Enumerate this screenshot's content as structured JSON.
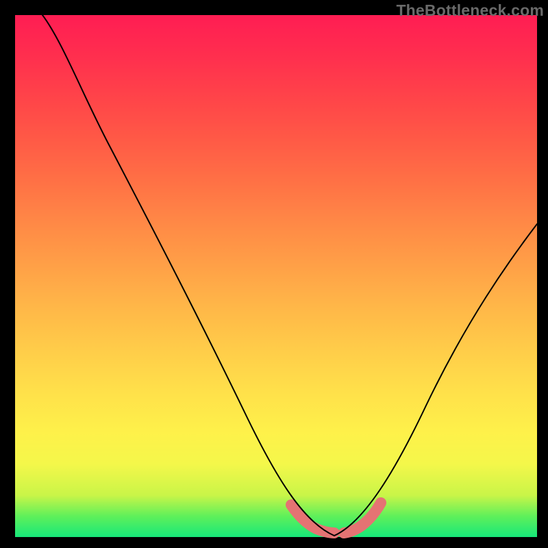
{
  "watermark": "TheBottleneck.com",
  "colors": {
    "frame": "#000000",
    "curve": "#000000",
    "highlight": "#e57373",
    "gradient_stops": [
      "#16e87a",
      "#fef14a",
      "#ff1d53"
    ]
  },
  "chart_data": {
    "type": "line",
    "title": "",
    "xlabel": "",
    "ylabel": "",
    "xlim": [
      0,
      100
    ],
    "ylim": [
      0,
      100
    ],
    "grid": false,
    "legend": false,
    "series": [
      {
        "name": "bottleneck-curve",
        "x": [
          0,
          5,
          10,
          15,
          20,
          25,
          30,
          35,
          40,
          45,
          50,
          55,
          57,
          59,
          61,
          63,
          65,
          67,
          70,
          75,
          80,
          85,
          90,
          95,
          100
        ],
        "values": [
          100,
          100,
          94,
          87,
          80,
          72,
          64,
          55,
          46,
          36,
          26,
          15,
          10,
          5,
          2,
          0,
          0,
          2,
          6,
          14,
          24,
          34,
          44,
          53,
          60
        ]
      },
      {
        "name": "optimal-zone-highlight",
        "x": [
          55,
          57,
          59,
          61,
          63,
          65,
          67,
          69
        ],
        "values": [
          6,
          3,
          1,
          0,
          0,
          1,
          3,
          6
        ]
      }
    ],
    "annotations": []
  }
}
